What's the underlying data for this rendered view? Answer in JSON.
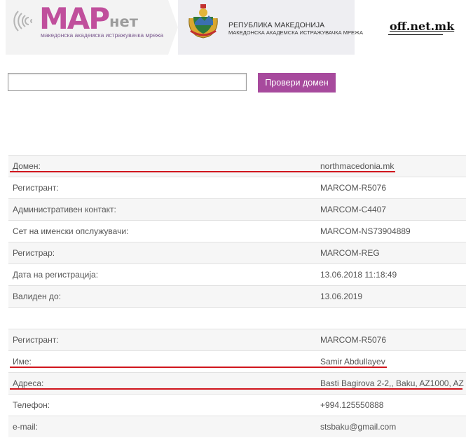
{
  "header": {
    "logo_main": "MAP",
    "logo_net": "нет",
    "logo_tagline": "македонска академска истражувачка мрежа",
    "republic_title": "РЕПУБЛИКА МАКЕДОНИЈА",
    "republic_subtitle": "МАКЕДОНСКА АКАДЕМСКА ИСТРАЖУВАЧКА МРЕЖА",
    "watermark": "off.net.mk"
  },
  "search": {
    "value": "",
    "button_label": "Провери домен",
    "button_color": "#a74a9d"
  },
  "domain_info": [
    {
      "label": "Домен:",
      "value": "northmacedonia.mk",
      "underlined": true
    },
    {
      "label": "Регистрант:",
      "value": "MARCOM-R5076"
    },
    {
      "label": "Административен контакт:",
      "value": "MARCOM-C4407"
    },
    {
      "label": "Сет на именски опслужувачи:",
      "value": "MARCOM-NS73904889"
    },
    {
      "label": "Регистрар:",
      "value": "MARCOM-REG"
    },
    {
      "label": "Дата на регистрација:",
      "value": "13.06.2018 11:18:49"
    },
    {
      "label": "Валиден до:",
      "value": "13.06.2019"
    }
  ],
  "registrant_info": [
    {
      "label": "Регистрант:",
      "value": "MARCOM-R5076"
    },
    {
      "label": "Име:",
      "value": "Samir Abdullayev",
      "underlined": true
    },
    {
      "label": "Адреса:",
      "value": "Basti Bagirova 2-2,, Baku, AZ1000, AZ",
      "underlined": true
    },
    {
      "label": "Телефон:",
      "value": "+994.125550888"
    },
    {
      "label": "e-mail:",
      "value": "stsbaku@gmail.com"
    }
  ],
  "annotation_color": "#d0151d"
}
